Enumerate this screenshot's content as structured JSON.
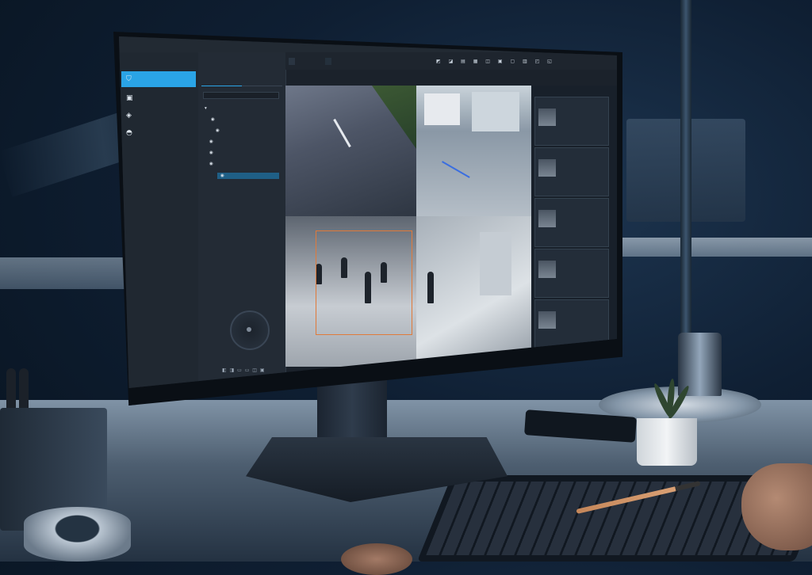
{
  "app": {
    "title": "",
    "nav_header": ""
  },
  "nav": {
    "items": [
      {
        "label": "",
        "icon": "shield-icon",
        "active": true
      },
      {
        "label": "",
        "icon": "monitor-icon",
        "active": false
      },
      {
        "label": "",
        "icon": "map-icon",
        "active": false
      },
      {
        "label": "",
        "icon": "dome-camera-icon",
        "active": false
      }
    ]
  },
  "panel": {
    "title": "",
    "tabs": [
      "",
      ""
    ],
    "search_placeholder": "",
    "tree": [
      "",
      "",
      "",
      "",
      "",
      "",
      ""
    ],
    "ptz_title": "",
    "ptz_subtitle": ""
  },
  "video_toolbar": {
    "tabs": [
      "",
      ""
    ]
  },
  "events": {
    "items": [
      "",
      "",
      "",
      "",
      ""
    ]
  },
  "colors": {
    "accent": "#2aa4e6",
    "detection_box": "#e07a3a",
    "panel_bg": "#232b35"
  }
}
